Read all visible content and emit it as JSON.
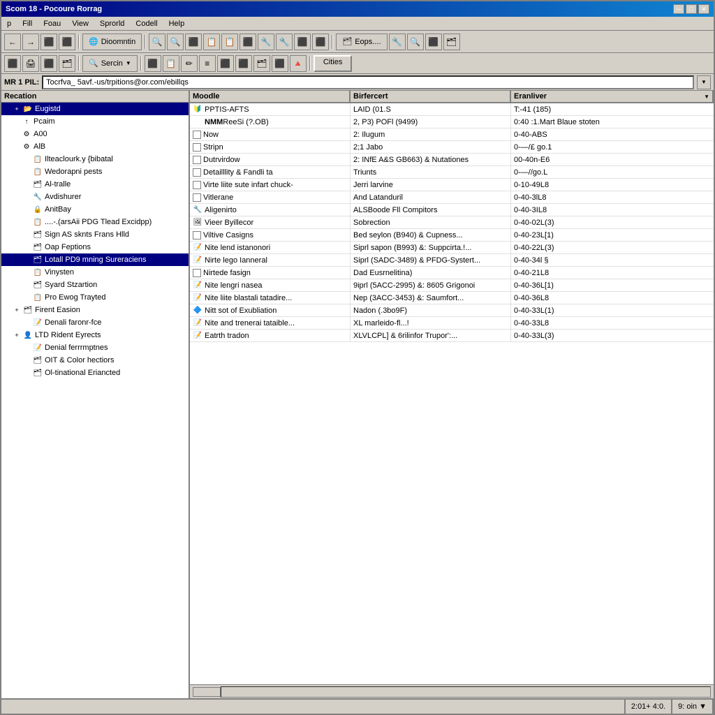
{
  "window": {
    "title": "Scom 18 - Pocoure Rorrag",
    "min_btn": "─",
    "max_btn": "□",
    "close_btn": "✕"
  },
  "menu": {
    "items": [
      "p",
      "Fill",
      "Foau",
      "View",
      "Sprorld",
      "Codell",
      "Help"
    ]
  },
  "toolbar1": {
    "address_btn": "Dioomntin",
    "eops_btn": "Eops...."
  },
  "toolbar2": {
    "search_btn": "Sercin",
    "cities_btn": "Cities"
  },
  "address_bar": {
    "label": "MR 1 PIL:",
    "value": "Tocrfva_ 5avf.-us/trpitions@or.com/ebillqs"
  },
  "sidebar": {
    "header": "Recation",
    "items": [
      {
        "indent": 1,
        "icon": "📂",
        "label": "Eugistd",
        "expand": "+",
        "selected": true
      },
      {
        "indent": 1,
        "icon": "↑",
        "label": "Pcaim",
        "expand": ""
      },
      {
        "indent": 1,
        "icon": "⚙",
        "label": "A00",
        "expand": ""
      },
      {
        "indent": 1,
        "icon": "⚙",
        "label": "AlB",
        "expand": ""
      },
      {
        "indent": 2,
        "icon": "📋",
        "label": "Ilteaclourk.y {bibatal",
        "expand": ""
      },
      {
        "indent": 2,
        "icon": "📋",
        "label": "Wedorapni pests",
        "expand": ""
      },
      {
        "indent": 2,
        "icon": "🗂",
        "label": "Al-tralle",
        "expand": ""
      },
      {
        "indent": 2,
        "icon": "🔧",
        "label": "Avdishurer",
        "expand": ""
      },
      {
        "indent": 2,
        "icon": "🔒",
        "label": "AnitBay",
        "expand": ""
      },
      {
        "indent": 2,
        "icon": "📋",
        "label": "....-.(arsAii PDG Tlead Excidpp)",
        "expand": ""
      },
      {
        "indent": 2,
        "icon": "🗂",
        "label": "Sign AS sknts Frans Hlld",
        "expand": ""
      },
      {
        "indent": 2,
        "icon": "🗂",
        "label": "Oap Feptions",
        "expand": ""
      },
      {
        "indent": 2,
        "icon": "🗂",
        "label": "Lotall PD9 mning Sureraciens",
        "expand": "",
        "selected": true
      },
      {
        "indent": 2,
        "icon": "📋",
        "label": "Vinysten",
        "expand": ""
      },
      {
        "indent": 2,
        "icon": "🗂",
        "label": "Syard Stzartion",
        "expand": ""
      },
      {
        "indent": 2,
        "icon": "📋",
        "label": "Pro Ewog Trayted",
        "expand": ""
      },
      {
        "indent": 1,
        "icon": "🗂",
        "label": "Firent Easion",
        "expand": "+"
      },
      {
        "indent": 2,
        "icon": "📝",
        "label": "Denali faronr-fce",
        "expand": ""
      },
      {
        "indent": 1,
        "icon": "👤",
        "label": "LTD Rident Eyrects",
        "expand": "+"
      },
      {
        "indent": 2,
        "icon": "📝",
        "label": "Denial ferrrmptnes",
        "expand": ""
      },
      {
        "indent": 2,
        "icon": "🗂",
        "label": "OIT & Color hectiors",
        "expand": ""
      },
      {
        "indent": 2,
        "icon": "🗂",
        "label": "Ol-tinational Eriancted",
        "expand": ""
      }
    ]
  },
  "list": {
    "columns": [
      "Moodle",
      "Birfercert",
      "Eranliver"
    ],
    "rows": [
      {
        "icon": "🔰",
        "has_check": false,
        "col1": "PPTIS-AFTS",
        "col2": "LAID (01.S",
        "col3": "T:-41 (185)"
      },
      {
        "icon": null,
        "has_check": false,
        "col1": "ReeSi (?.OB)",
        "col2": "2, P3) POFl (9499)",
        "col3": "0:40 :1.Mart Blaue stoten",
        "special": "NMM"
      },
      {
        "icon": null,
        "has_check": true,
        "col1": "Now",
        "col2": "2: Ilugum",
        "col3": "0-40-ABS"
      },
      {
        "icon": null,
        "has_check": true,
        "col1": "Stripn",
        "col2": "2;1 Jabo",
        "col3": "0-—/£ go.1"
      },
      {
        "icon": null,
        "has_check": true,
        "col1": "Dutrvirdow",
        "col2": "2: INfE A&S GB663) & Nutationes",
        "col3": "00-40n-E6"
      },
      {
        "icon": null,
        "has_check": true,
        "col1": "Detailllity & Fandli ta",
        "col2": "Triunts",
        "col3": "0-—//go.L"
      },
      {
        "icon": null,
        "has_check": true,
        "col1": "Virte liite sute infart chuck-",
        "col2": "Jerri larvine",
        "col3": "0-10-49L8"
      },
      {
        "icon": null,
        "has_check": true,
        "col1": "Vitlerane",
        "col2": "And Latanduril",
        "col3": "0-40-3lL8"
      },
      {
        "icon": "🔧",
        "has_check": false,
        "col1": "Aligenirto",
        "col2": "ALSBoode Fll Compitors",
        "col3": "0-40-3IL8"
      },
      {
        "icon": "🖼",
        "has_check": false,
        "col1": "Vieer Byillecor",
        "col2": "Sobrection",
        "col3": "0-40-02L(3)"
      },
      {
        "icon": null,
        "has_check": true,
        "col1": "Viltive Casigns",
        "col2": "Bed seylon (B940) & Cupness...",
        "col3": "0-40-23L[1)"
      },
      {
        "icon": "📝",
        "has_check": false,
        "col1": "Nite lend istanonori",
        "col2": "Siprl sapon (B993) &: Suppcirta.!...",
        "col3": "0-40-22L(3)"
      },
      {
        "icon": "📝",
        "has_check": false,
        "col1": "Nirte lego Ianneral",
        "col2": "Siprl (SADC-3489) & PFDG-Systert...",
        "col3": "0-40-34l §"
      },
      {
        "icon": null,
        "has_check": true,
        "col1": "Nirtede fasign",
        "col2": "Dad Eusrnelitina)",
        "col3": "0-40-21L8"
      },
      {
        "icon": "📝",
        "has_check": false,
        "col1": "Nite lengri nasea",
        "col2": "9iprl (5ACC-2995) &: 8605 Grigonoi",
        "col3": "0-40-36L[1)"
      },
      {
        "icon": "📝",
        "has_check": false,
        "col1": "Nite liite blastali tatadire...",
        "col2": "Nep (3ACC-3453) &: Saumfort...",
        "col3": "0-40-36L8"
      },
      {
        "icon": "🔷",
        "has_check": false,
        "col1": "Nitt sot of Exubliation",
        "col2": "Nadon (.3bo9F)",
        "col3": "0-40-33L(1)"
      },
      {
        "icon": "📝",
        "has_check": false,
        "col1": "Nite and trenerai tataible...",
        "col2": "XL marleido-fl...!",
        "col3": "0-40-33L8"
      },
      {
        "icon": "📝",
        "has_check": false,
        "col1": "Eatrth tradon",
        "col2": "XLVLCPL] & 6rilinfor Trupor':...",
        "col3": "0-40-33L(3)"
      }
    ]
  },
  "statusbar": {
    "left": "",
    "middle": "2:01+ 4:0.",
    "right": "9: oin ▼"
  }
}
